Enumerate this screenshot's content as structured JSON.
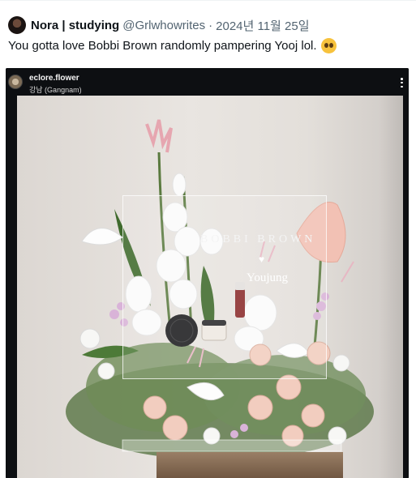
{
  "tweet": {
    "display_name": "Nora | studying",
    "handle": "@Grlwhowrites",
    "separator": "·",
    "timestamp": "2024년 11월 25일",
    "text": "You gotta love Bobbi Brown randomly pampering Yooj lol.",
    "emoji_icon": "pleading-face-icon"
  },
  "media": {
    "account_name": "eclore.flower",
    "location": "강남 (Gangnam)",
    "menu_icon": "more-vertical-icon",
    "photo": {
      "sign_brand": "BOBBI BROWN",
      "sign_name": "Youjung",
      "heart_icon": "heart-icon"
    }
  },
  "colors": {
    "text_primary": "#0f1419",
    "text_secondary": "#536471",
    "media_bg": "#0d0f12",
    "wall": "#e6e2de"
  }
}
